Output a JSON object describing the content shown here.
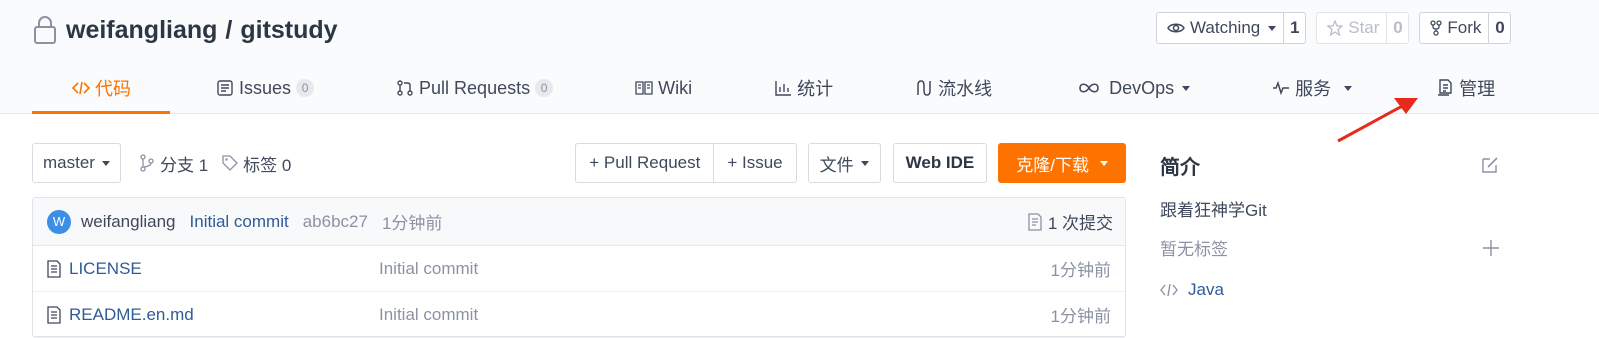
{
  "repo": {
    "owner": "weifangliang",
    "separator": "/",
    "name": "gitstudy"
  },
  "actions": {
    "watch_label": "Watching",
    "watch_count": "1",
    "star_label": "Star",
    "star_count": "0",
    "fork_label": "Fork",
    "fork_count": "0"
  },
  "tabs": [
    {
      "label": "代码",
      "icon": "code-icon"
    },
    {
      "label": "Issues",
      "badge": "0",
      "icon": "issues-icon"
    },
    {
      "label": "Pull Requests",
      "badge": "0",
      "icon": "pull-request-icon"
    },
    {
      "label": "Wiki",
      "icon": "book-icon"
    },
    {
      "label": "统计",
      "icon": "chart-icon"
    },
    {
      "label": "流水线",
      "icon": "pipeline-icon"
    },
    {
      "label": "DevOps",
      "icon": "infinity-icon"
    },
    {
      "label": "服务",
      "icon": "pulse-icon"
    },
    {
      "label": "管理",
      "icon": "document-icon"
    }
  ],
  "toolbar": {
    "branch": "master",
    "branches_label": "分支 1",
    "tags_label": "标签 0",
    "pull_request_label": "+ Pull Request",
    "issue_label": "+ Issue",
    "file_label": "文件",
    "web_ide_label": "Web IDE",
    "clone_label": "克隆/下载"
  },
  "commit": {
    "avatar_letter": "W",
    "author": "weifangliang",
    "message": "Initial commit",
    "hash": "ab6bc27",
    "time": "1分钟前",
    "count_label": "1 次提交"
  },
  "files": [
    {
      "name": "LICENSE",
      "commit": "Initial commit",
      "time": "1分钟前"
    },
    {
      "name": "README.en.md",
      "commit": "Initial commit",
      "time": "1分钟前"
    }
  ],
  "sidebar": {
    "title": "简介",
    "description": "跟着狂神学Git",
    "tags_empty": "暂无标签",
    "language": "Java"
  },
  "colors": {
    "accent": "#fe7300",
    "link": "#2f5b97",
    "arrow": "#e8291c"
  }
}
